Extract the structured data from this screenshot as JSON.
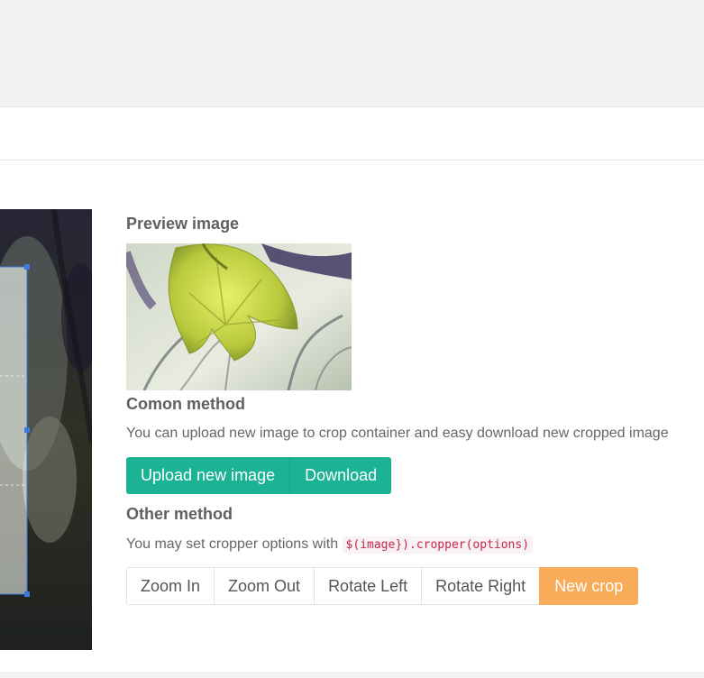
{
  "preview": {
    "title": "Preview image"
  },
  "common": {
    "title": "Comon method",
    "description": "You can upload new image to crop container and easy download new cropped image",
    "upload_label": "Upload new image",
    "download_label": "Download"
  },
  "other": {
    "title": "Other method",
    "description_prefix": "You may set cropper options with",
    "code": "$(image}).cropper(options)",
    "buttons": {
      "zoom_in": "Zoom In",
      "zoom_out": "Zoom Out",
      "rotate_left": "Rotate Left",
      "rotate_right": "Rotate Right",
      "new_crop": "New crop"
    }
  },
  "colors": {
    "primary_green": "#1bb394",
    "warning_orange": "#f8ac59",
    "crop_box_blue": "#3b7bdb"
  }
}
